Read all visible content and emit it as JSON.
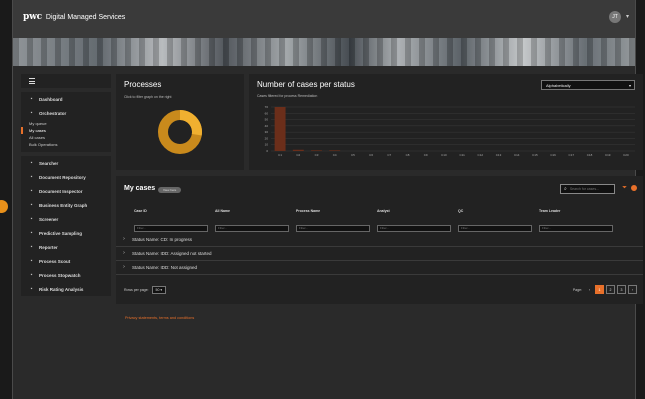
{
  "header": {
    "logo": "pwc",
    "title": "Digital Managed Services",
    "avatar": "JT",
    "avatar_chevron": "▾"
  },
  "sidebar": {
    "items": [
      {
        "label": "Dashboard",
        "icon": "dashboard-icon"
      },
      {
        "label": "Orchestrator",
        "icon": "user-icon"
      }
    ],
    "orchestrator_sub": [
      "My queue",
      "My cases",
      "All cases",
      "Bulk Operations"
    ],
    "active_sub": "My cases",
    "items2": [
      {
        "label": "Searcher",
        "icon": "search-icon"
      },
      {
        "label": "Document Repository",
        "icon": "document-icon"
      },
      {
        "label": "Document Inspector",
        "icon": "inspect-icon"
      },
      {
        "label": "Business Entity Graph",
        "icon": "graph-icon"
      },
      {
        "label": "Screener",
        "icon": "screener-icon"
      },
      {
        "label": "Predictive Sampling",
        "icon": "sampling-icon"
      },
      {
        "label": "Reporter",
        "icon": "reporter-icon"
      },
      {
        "label": "Process Scout",
        "icon": "scout-icon"
      },
      {
        "label": "Process Stopwatch",
        "icon": "stopwatch-icon"
      },
      {
        "label": "Risk Rating Analysis",
        "icon": "risk-icon"
      }
    ]
  },
  "processes": {
    "title": "Processes",
    "subtitle": "Click to filter graph on the right"
  },
  "cases_chart": {
    "title": "Number of cases per status",
    "subtitle": "Cases filtered for process Remediation",
    "sort_value": "Alphabetically",
    "sort_chevron": "▾"
  },
  "chart_data": [
    {
      "type": "pie",
      "title": "Processes",
      "values": [
        100
      ],
      "colors": [
        "#c98a1c"
      ]
    },
    {
      "type": "bar",
      "title": "Number of cases per status",
      "categories": [
        "C1",
        "C2",
        "C3",
        "C4",
        "C5",
        "C6",
        "C7",
        "C8",
        "C9",
        "C10",
        "C11",
        "C12",
        "C13",
        "C14",
        "C15",
        "C16",
        "C17",
        "C18",
        "C19",
        "C20"
      ],
      "values": [
        70,
        2,
        1,
        1,
        0,
        0,
        0,
        0,
        0,
        0,
        0,
        0,
        0,
        0,
        0,
        0,
        0,
        0,
        0,
        0
      ],
      "yticks": [
        70,
        60,
        50,
        40,
        30,
        20,
        10,
        0
      ],
      "ylim": [
        0,
        70
      ],
      "color": "#6b2e1a"
    }
  ],
  "my_cases": {
    "title": "My cases",
    "badge": "View here",
    "search_placeholder": "Search for cases...",
    "columns": [
      {
        "label": "Case ID",
        "placeholder": "Filter..."
      },
      {
        "label": "All Name",
        "placeholder": "Filter..."
      },
      {
        "label": "Process Name",
        "placeholder": "Filter..."
      },
      {
        "label": "Analyst",
        "placeholder": "Filter..."
      },
      {
        "label": "QC",
        "placeholder": "Filter..."
      },
      {
        "label": "Team Leader",
        "placeholder": "Filter..."
      }
    ],
    "status_rows": [
      "Status Name: CD: In progress",
      "Status Name: IDD: Assigned not started",
      "Status Name: IDD: Not assigned"
    ],
    "rows_per_page_label": "Rows per page:",
    "rows_per_page_value": "50 ▾",
    "page_label": "Page:",
    "pages": [
      "1",
      "2",
      "3"
    ],
    "current_page": "1",
    "prev_icon": "‹",
    "next_icon": "›"
  },
  "footer": {
    "privacy": "Privacy statements, terms and conditions"
  }
}
